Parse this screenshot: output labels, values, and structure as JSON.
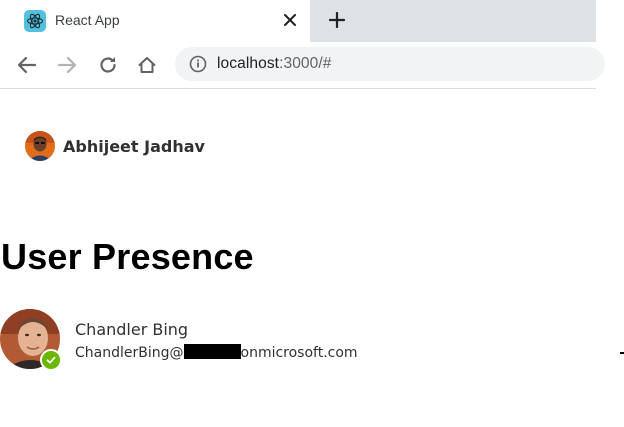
{
  "browser": {
    "tab": {
      "title": "React App",
      "favicon": "react-logo-icon",
      "close_icon": "close-icon"
    },
    "new_tab_icon": "plus-icon",
    "toolbar": {
      "back_icon": "arrow-left-icon",
      "forward_icon": "arrow-right-icon",
      "reload_icon": "reload-icon",
      "home_icon": "home-icon"
    },
    "address_bar": {
      "info_icon": "info-icon",
      "host": "localhost",
      "rest": ":3000/#"
    }
  },
  "header": {
    "signed_in_user": "Abhijeet Jadhav"
  },
  "main": {
    "title": "User Presence",
    "person": {
      "name": "Chandler Bing",
      "email_prefix": "ChandlerBing@",
      "email_suffix": "onmicrosoft.com",
      "presence": "available",
      "presence_icon": "checkmark-icon"
    }
  },
  "colors": {
    "tabstrip": "#dee1e6",
    "omnibox": "#f1f3f4",
    "favicon": "#53c1de",
    "presence_available": "#6bb700",
    "text": "#323130"
  }
}
